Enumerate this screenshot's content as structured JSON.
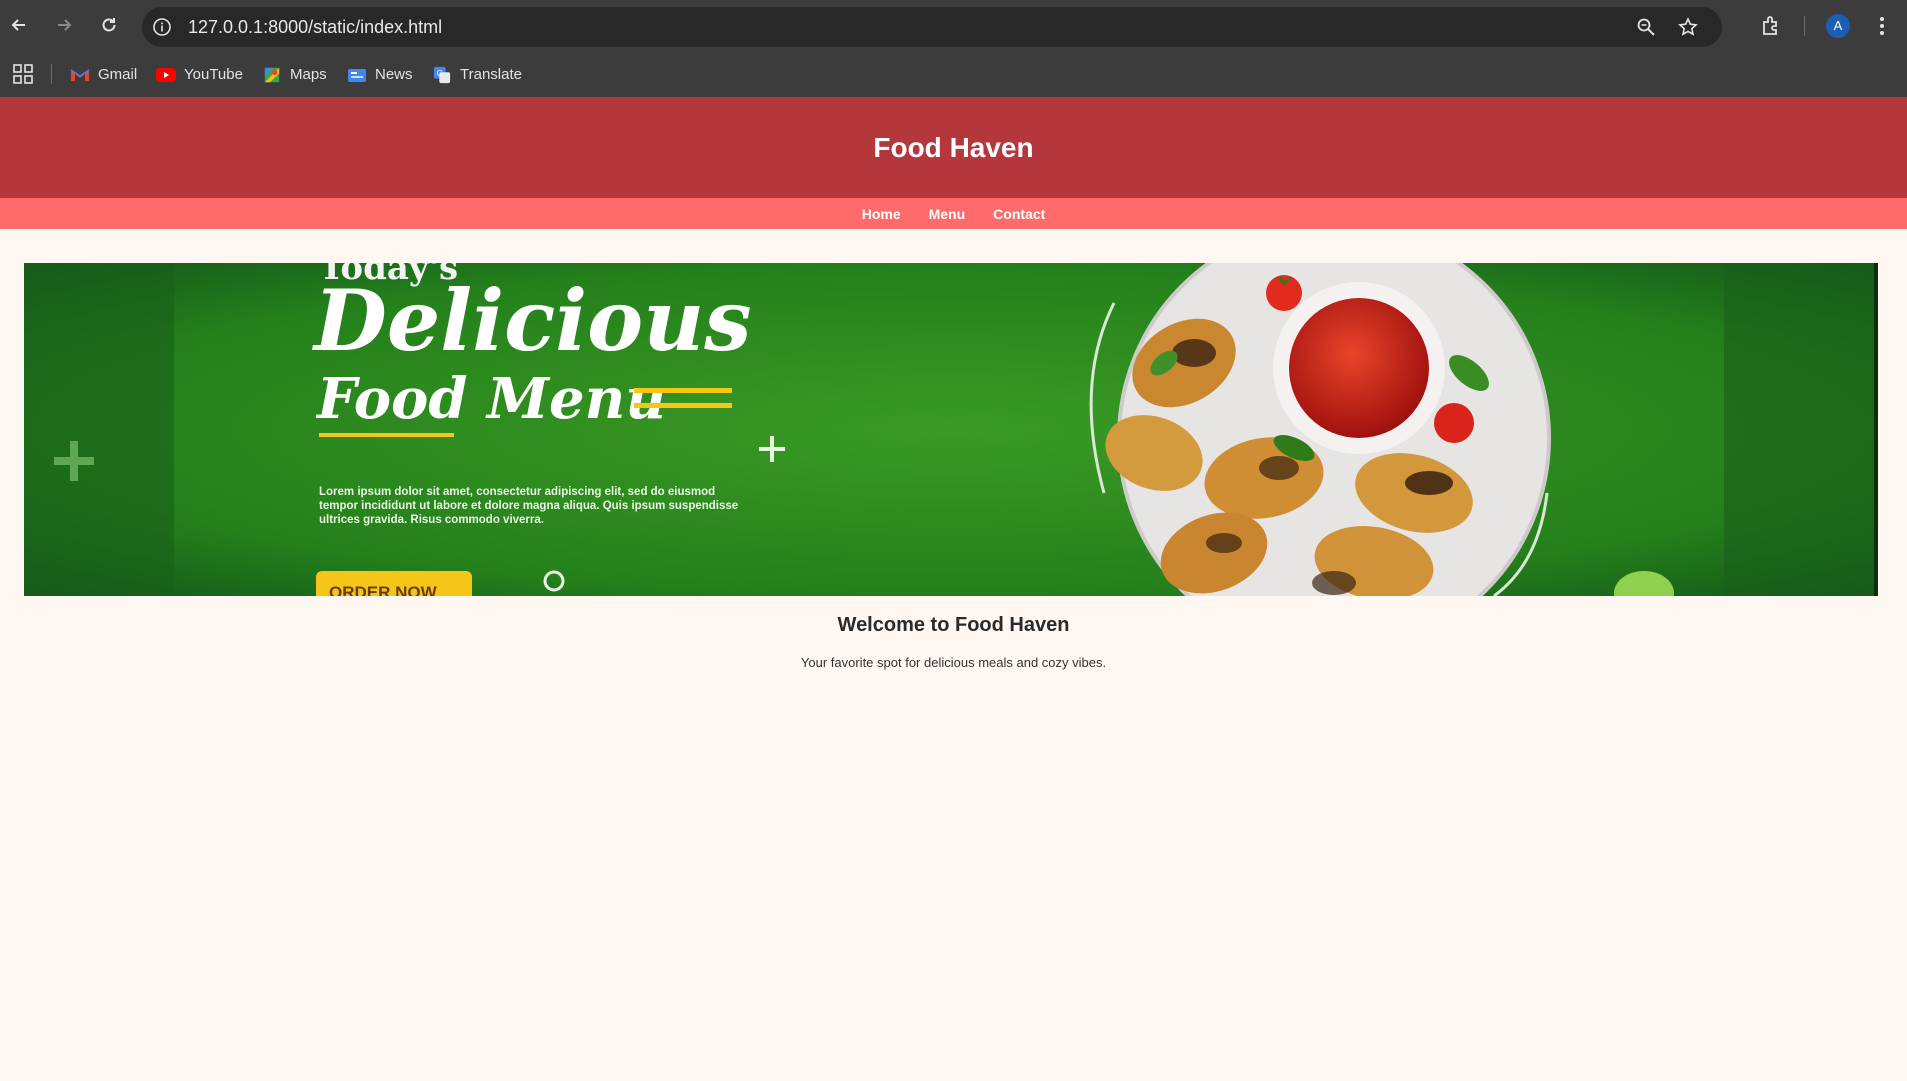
{
  "browser": {
    "url": "127.0.0.1:8000/static/index.html",
    "profile_initial": "A",
    "bookmarks": [
      {
        "label": "Gmail",
        "icon": "gmail-icon"
      },
      {
        "label": "YouTube",
        "icon": "youtube-icon"
      },
      {
        "label": "Maps",
        "icon": "maps-icon"
      },
      {
        "label": "News",
        "icon": "news-icon"
      },
      {
        "label": "Translate",
        "icon": "translate-icon"
      }
    ]
  },
  "site": {
    "title": "Food Haven",
    "nav": [
      "Home",
      "Menu",
      "Contact"
    ],
    "banner": {
      "line1": "Today's",
      "line2": "Delicious",
      "line3": "Food Menu",
      "body": "Lorem ipsum dolor sit amet, consectetur adipiscing elit, sed do eiusmod tempor incididunt ut labore et dolore magna aliqua. Quis ipsum suspendisse ultrices gravida. Risus commodo viverra.",
      "cta": "ORDER NOW"
    },
    "welcome": "Welcome to Food Haven",
    "tagline": "Your favorite spot for delicious meals and cozy vibes."
  },
  "colors": {
    "header": "#b3373b",
    "nav": "#ff6b6b",
    "page_bg": "#fff7f2",
    "banner_green": "#2e8b22"
  }
}
